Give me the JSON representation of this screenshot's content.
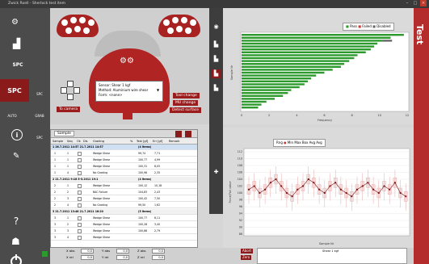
{
  "window": {
    "title": "Zwick Roell - Sherlock test item",
    "controls": [
      "–",
      "□",
      "×"
    ]
  },
  "sidebar": {
    "items": [
      {
        "name": "robot",
        "label": ""
      },
      {
        "name": "samples",
        "label": ""
      },
      {
        "name": "spc-settings",
        "label": "SPC"
      },
      {
        "name": "spc",
        "label": "SPC"
      },
      {
        "name": "spc-sub",
        "label": "SPC"
      },
      {
        "name": "auto",
        "label": "AUTO"
      },
      {
        "name": "grab",
        "label": "GRAB"
      },
      {
        "name": "info",
        "label": "i"
      },
      {
        "name": "spc-small",
        "label": "SPC"
      },
      {
        "name": "help",
        "label": "?"
      }
    ]
  },
  "machine": {
    "info_lines": [
      "Sensor: Shear 1 kgf",
      "Method: Aluminium wire shear",
      "Form: <none>"
    ],
    "to_camera": "To camera",
    "tool_change": "Tool change",
    "mu_change": "MU change",
    "detect_surface": "Detect surface"
  },
  "chart_top": {
    "legend": [
      "Pass",
      "Failed",
      "Disabled"
    ],
    "ylabel": "Sample Nr",
    "xlabel": "Frequency",
    "xticks": [
      "0",
      "2",
      "4",
      "6",
      "8",
      "10",
      "12"
    ],
    "colors": {
      "pass": "#2c9a2c",
      "fail": "#c83a3a",
      "disabled": "#666666"
    }
  },
  "chart_bottom": {
    "legend": [
      "Rng",
      "Min",
      "Max",
      "Box",
      "Avg",
      "Avg"
    ],
    "ylabel": "Force/Fail value",
    "xlabel": "Sample Nr",
    "yticks": [
      "112",
      "110",
      "108",
      "106",
      "104",
      "102",
      "100",
      "98",
      "96",
      "94",
      "92",
      "90",
      "88"
    ]
  },
  "side_label": "Test",
  "table": {
    "title": "Sample",
    "headers": [
      "Sample",
      "Seq",
      "Ok",
      "Dis",
      "Grading",
      "%",
      "Test [gf]",
      "Err [gf]",
      "Remark"
    ],
    "rows": [
      {
        "group": true,
        "text": "1  26.7.2011  14:57  21.7.2011  14:57",
        "sel": true,
        "extra": "(4 items)"
      },
      {
        "c1": "1",
        "c2": "1",
        "grading": "Wedge Shear",
        "test": "99,74",
        "err": "7,71"
      },
      {
        "c1": "1",
        "c2": "1",
        "grading": "Wedge Shear",
        "test": "100,77",
        "err": "4,99"
      },
      {
        "c1": "1",
        "c2": "1",
        "grading": "Wedge Shear",
        "test": "100,31",
        "err": "8,05"
      },
      {
        "c1": "1",
        "c2": "4",
        "grading": "No Grading",
        "test": "100,96",
        "err": "2,35"
      },
      {
        "group": true,
        "text": "2  21.7.2011  9:18  5-5.2011  19:1",
        "sel": false,
        "extra": "(4 items)"
      },
      {
        "c1": "2",
        "c2": "1",
        "grading": "Wedge Shear",
        "test": "100,12",
        "err": "10,18"
      },
      {
        "c1": "2",
        "c2": "2",
        "grading": "BAC Failure",
        "test": "104,83",
        "err": "2,43"
      },
      {
        "c1": "2",
        "c2": "3",
        "grading": "Wedge Shear",
        "test": "100,42",
        "err": "7,50"
      },
      {
        "c1": "2",
        "c2": "4",
        "grading": "No Grading",
        "test": "99,50",
        "err": "1,62"
      },
      {
        "group": true,
        "text": "3  21.7.2011  13:48  21.7.2011  16:20",
        "sel": false,
        "extra": "(5 items)"
      },
      {
        "c1": "3",
        "c2": "1",
        "grading": "Wedge Shear",
        "test": "100,77",
        "err": "8,11"
      },
      {
        "c1": "3",
        "c2": "2",
        "grading": "Wedge Shear",
        "test": "100,28",
        "err": "3,40"
      },
      {
        "c1": "3",
        "c2": "3",
        "grading": "Wedge Shear",
        "test": "100,86",
        "err": "2,79"
      },
      {
        "c1": "3",
        "c2": "4",
        "grading": "Wedge Shear",
        "test": "",
        "err": ""
      }
    ]
  },
  "bottom": {
    "x_abs_label": "X abs",
    "x_abs": "0,0",
    "x_rel_label": "X rel",
    "x_rel": "0,0",
    "y_abs_label": "Y abs",
    "y_abs": "0,0",
    "y_rel_label": "Y rel",
    "y_rel": "0,0",
    "z_abs_label": "Z abs",
    "z_abs": "0,0",
    "z_rel_label": "Z rel",
    "z_rel": "0,0",
    "abort": "Abort",
    "zero": "Zero",
    "shear_label": "Shear 1 kgf"
  }
}
